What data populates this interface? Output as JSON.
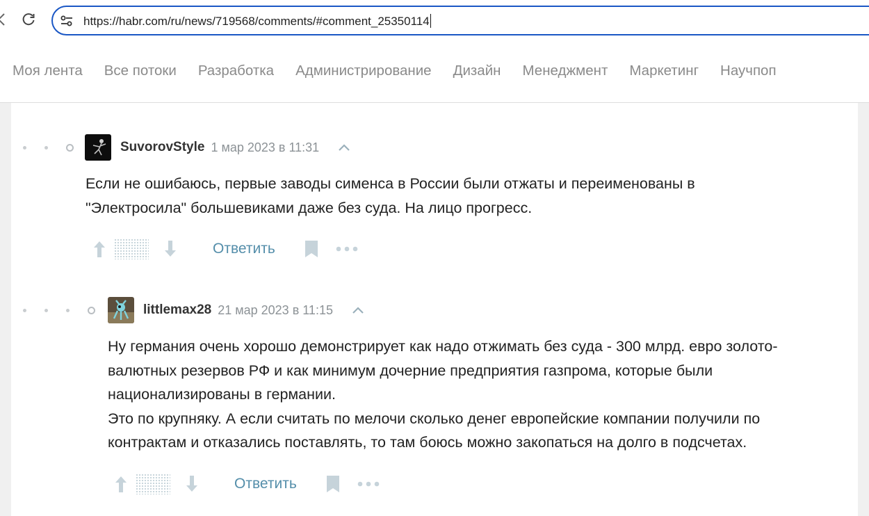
{
  "browser": {
    "url": "https://habr.com/ru/news/719568/comments/#comment_25350114"
  },
  "flows": [
    "Моя лента",
    "Все потоки",
    "Разработка",
    "Администрирование",
    "Дизайн",
    "Менеджмент",
    "Маркетинг",
    "Научпоп"
  ],
  "comments": [
    {
      "author": "SuvorovStyle",
      "date": "1 мар 2023 в 11:31",
      "lines": [
        "Если не ошибаюсь, первые заводы сименса в России были отжаты и переименованы в",
        "\"Электросила\" большевиками даже без суда. На лицо прогресс."
      ],
      "reply_label": "Ответить"
    },
    {
      "author": "littlemax28",
      "date": "21 мар 2023 в 11:15",
      "lines": [
        "Ну германия очень хорошо демонстрирует как надо отжимать без суда - 300 млрд. евро золото-",
        "валютных резервов РФ и как минимум дочерние предприятия газпрома, которые были",
        "национализированы в германии.",
        "Это по крупняку. А если считать по мелочи сколько денег европейские компании получили по",
        "контрактам и отказались поставлять, то там боюсь можно закопаться на долго в подсчетах."
      ],
      "reply_label": "Ответить"
    }
  ],
  "colors": {
    "accent": "#548eaa",
    "url_border": "#1a57c5",
    "muted": "#8a8a8a"
  },
  "icons": [
    "back-icon",
    "reload-icon",
    "site-settings-icon",
    "vote-up-icon",
    "vote-down-icon",
    "bookmark-icon",
    "more-icon",
    "collapse-icon"
  ]
}
